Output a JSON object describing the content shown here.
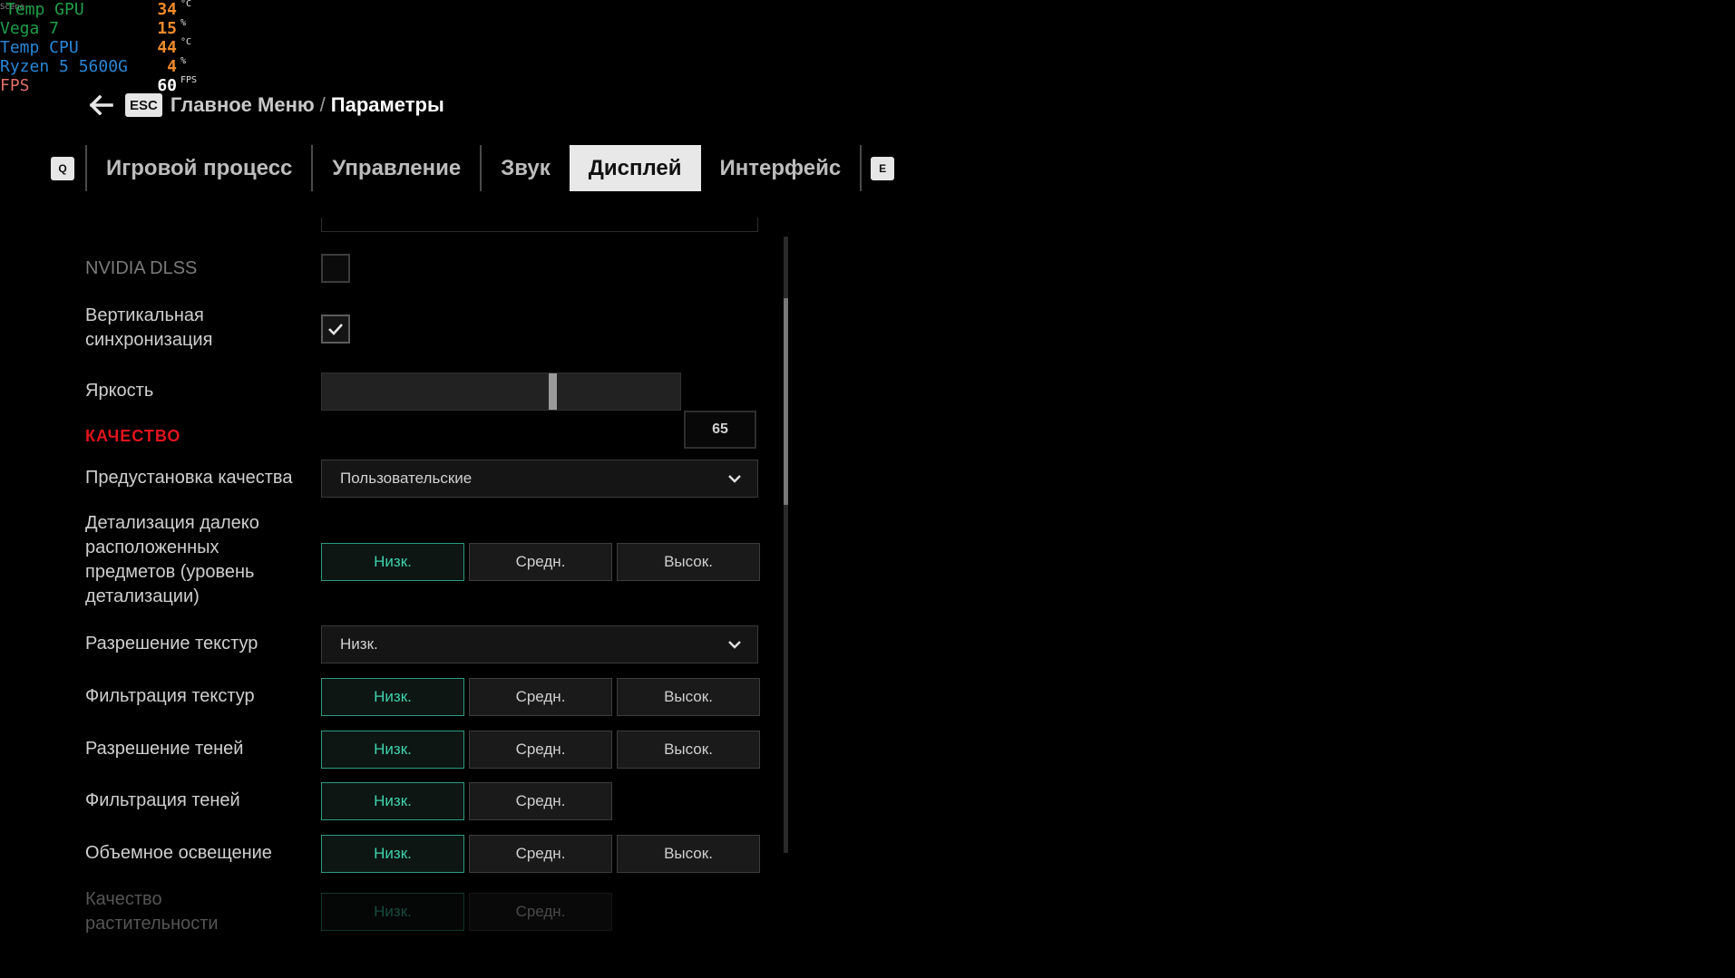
{
  "overlay": {
    "tiny": "Scene",
    "rows": [
      {
        "label": "Temp GPU",
        "value": "34",
        "unit": "°C",
        "color": "#1f9e4a"
      },
      {
        "label": "Vega 7",
        "value": "15",
        "unit": "%",
        "color": "#1f9e4a"
      },
      {
        "label": "Temp CPU",
        "value": "44",
        "unit": "°C",
        "color": "#2a86d6"
      },
      {
        "label": "Ryzen 5 5600G",
        "value": "4",
        "unit": "%",
        "color": "#2a86d6"
      },
      {
        "label": "FPS",
        "value": "60",
        "unit": "FPS",
        "color": "#e0706a"
      }
    ]
  },
  "header": {
    "back_icon": "arrow-left-icon",
    "esc_key": "ESC",
    "breadcrumb_parent": "Главное Меню",
    "separator": "/",
    "breadcrumb_current": "Параметры"
  },
  "tabs": {
    "prev_key": "Q",
    "next_key": "E",
    "items": [
      "Игровой процесс",
      "Управление",
      "Звук",
      "Дисплей",
      "Интерфейс"
    ],
    "active": "Дисплей"
  },
  "settings": {
    "dlss": {
      "label": "NVIDIA DLSS",
      "checked": false
    },
    "vsync": {
      "label": "Вертикальная синхронизация",
      "checked": true
    },
    "brightness": {
      "label": "Яркость",
      "value": "65"
    },
    "section_quality": "КАЧЕСТВО",
    "preset": {
      "label": "Предустановка качества",
      "value": "Пользовательские"
    },
    "lod": {
      "label": "Детализация далеко расположенных предметов (уровень детализации)",
      "options": [
        "Низк.",
        "Средн.",
        "Высок."
      ],
      "selected": "Низк."
    },
    "texture_res": {
      "label": "Разрешение текстур",
      "value": "Низк."
    },
    "texture_filter": {
      "label": "Фильтрация текстур",
      "options": [
        "Низк.",
        "Средн.",
        "Высок."
      ],
      "selected": "Низк."
    },
    "shadow_res": {
      "label": "Разрешение теней",
      "options": [
        "Низк.",
        "Средн.",
        "Высок."
      ],
      "selected": "Низк."
    },
    "shadow_filter": {
      "label": "Фильтрация теней",
      "options": [
        "Низк.",
        "Средн."
      ],
      "selected": "Низк."
    },
    "volumetric": {
      "label": "Объемное освещение",
      "options": [
        "Низк.",
        "Средн.",
        "Высок."
      ],
      "selected": "Низк."
    },
    "vegetation": {
      "label": "Качество растительности",
      "options": [
        "Низк.",
        "Средн."
      ],
      "selected": "Низк."
    }
  },
  "colors": {
    "accent_selected": "#3fd2ac",
    "section": "#e0141e"
  }
}
